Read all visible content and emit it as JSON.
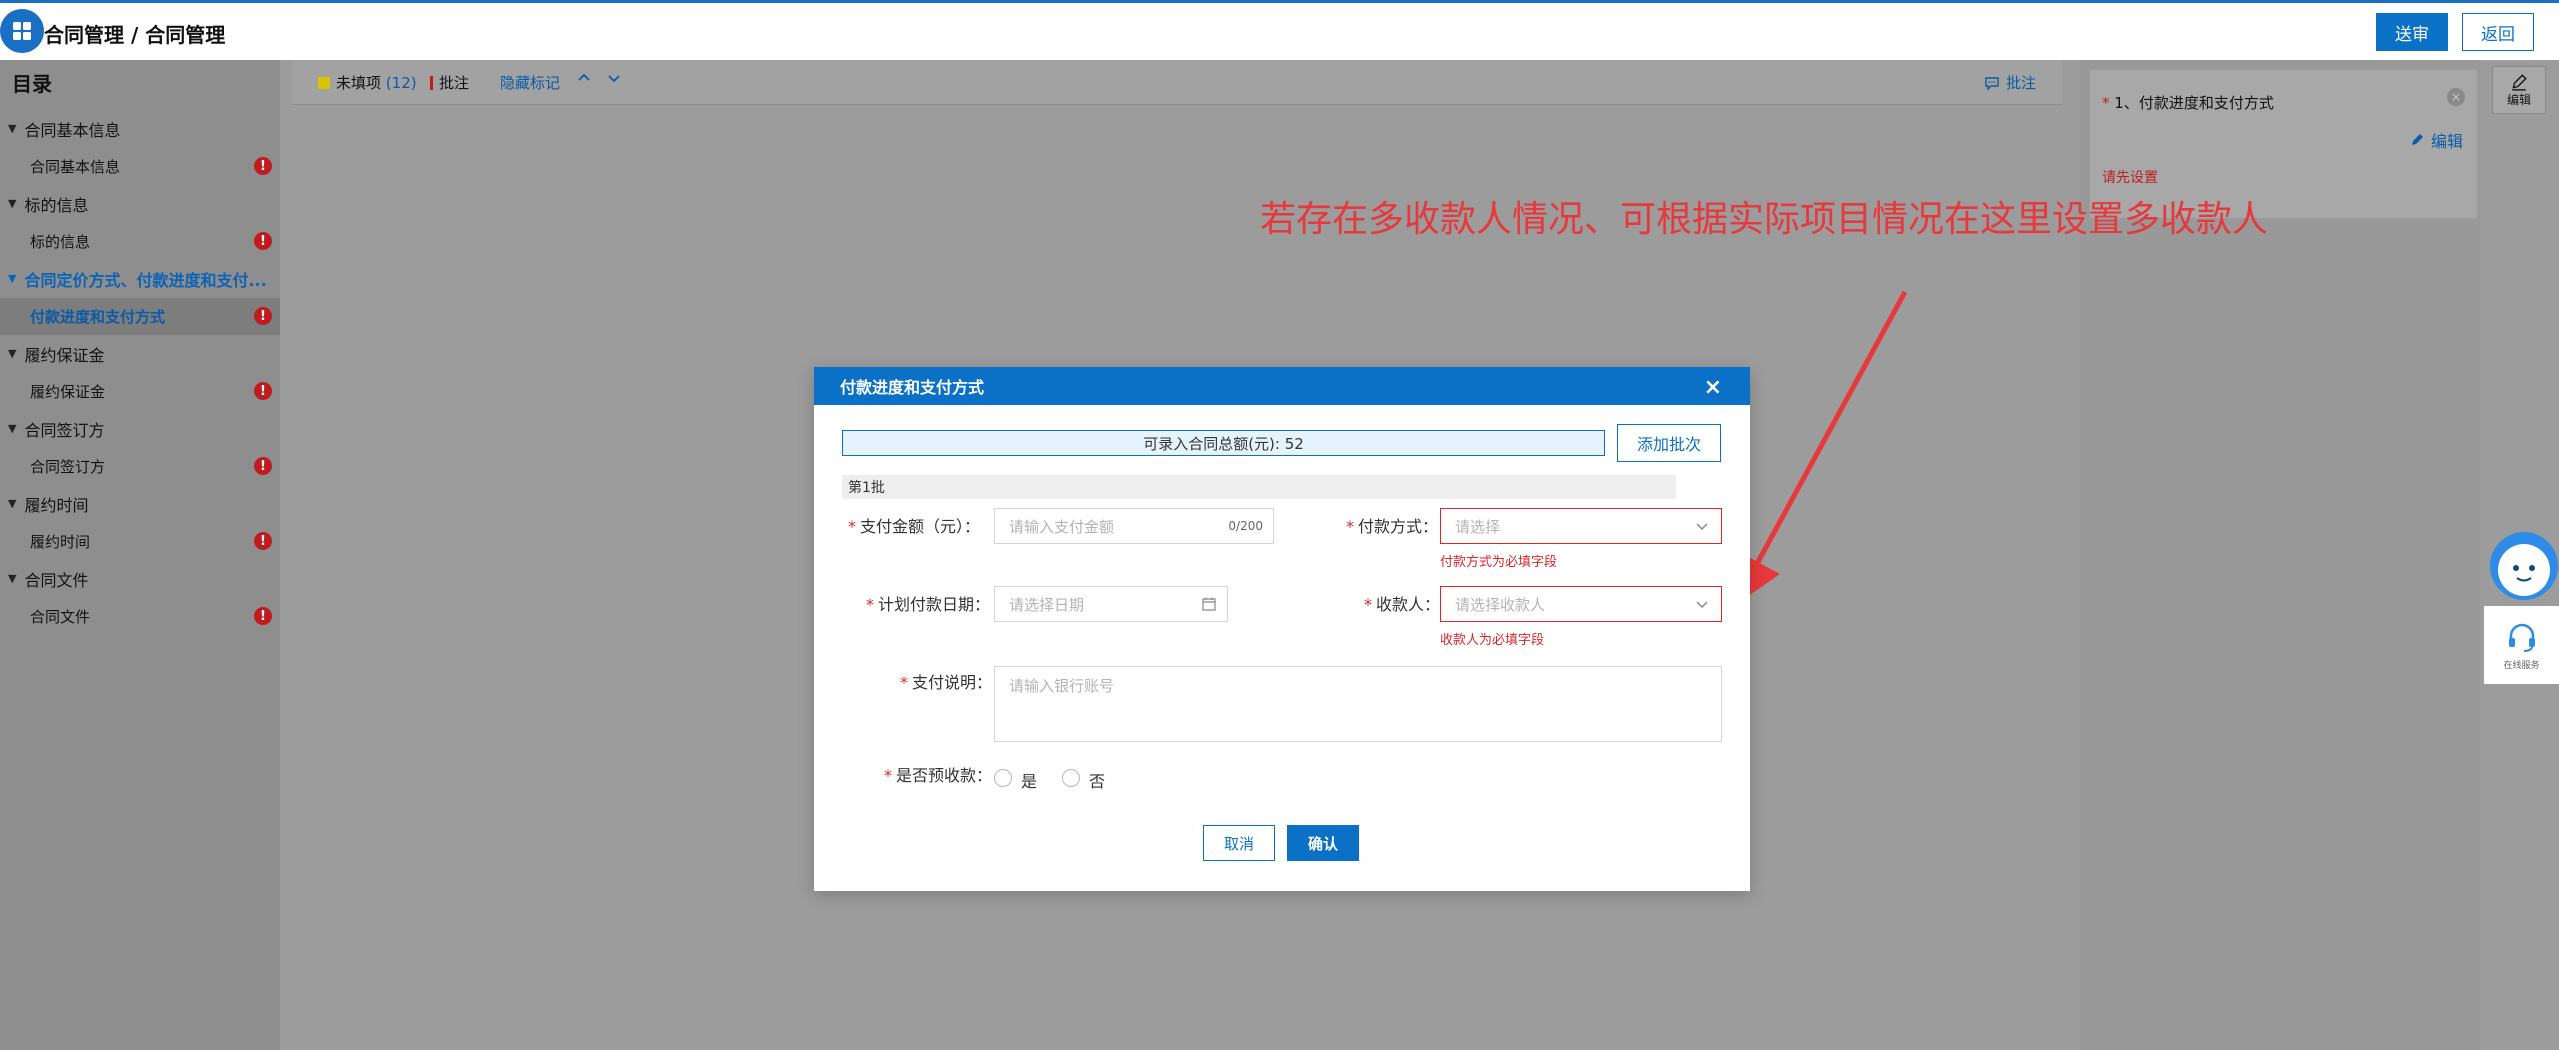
{
  "header": {
    "breadcrumb": "合同管理 / 合同管理",
    "submit_label": "送审",
    "back_label": "返回"
  },
  "toc": {
    "title": "目录",
    "groups": [
      {
        "label": "合同基本信息",
        "item": "合同基本信息"
      },
      {
        "label": "标的信息",
        "item": "标的信息"
      },
      {
        "label": "合同定价方式、付款进度和支付...",
        "item": "付款进度和支付方式"
      },
      {
        "label": "履约保证金",
        "item": "履约保证金"
      },
      {
        "label": "合同签订方",
        "item": "合同签订方"
      },
      {
        "label": "履约时间",
        "item": "履约时间"
      },
      {
        "label": "合同文件",
        "item": "合同文件"
      }
    ],
    "warn_symbol": "!"
  },
  "toolbar": {
    "unfilled_label": "未填项",
    "unfilled_count": "(12)",
    "annotate_label": "批注",
    "hide_marks_label": "隐藏标记",
    "comment_label": "批注"
  },
  "comment_panel": {
    "item_title": "1、付款进度和支付方式",
    "required_mark": "*",
    "edit_label": "编辑",
    "hint": "请先设置",
    "edit_strip_label": "编辑"
  },
  "annotation_text": "若存在多收款人情况、可根据实际项目情况在这里设置多收款人",
  "modal": {
    "title": "付款进度和支付方式",
    "close_symbol": "×",
    "total_text": "可录入合同总额(元): 52",
    "add_batch_label": "添加批次",
    "batch_title": "第1批",
    "fields": {
      "amount_label": "支付金额（元）：",
      "amount_placeholder": "请输入支付金额",
      "amount_counter": "0/200",
      "method_label": "付款方式：",
      "method_placeholder": "请选择",
      "method_error": "付款方式为必填字段",
      "date_label": "计划付款日期：",
      "date_placeholder": "请选择日期",
      "payee_label": "收款人：",
      "payee_placeholder": "请选择收款人",
      "payee_error": "收款人为必填字段",
      "desc_label": "支付说明：",
      "desc_placeholder": "请输入银行账号",
      "prepay_label": "是否预收款：",
      "yes_label": "是",
      "no_label": "否"
    },
    "cancel_label": "取消",
    "confirm_label": "确认"
  },
  "service": {
    "label": "在线服务"
  },
  "colors": {
    "primary": "#0a71c7",
    "error": "#e0262a",
    "annotation": "#e8383b"
  }
}
